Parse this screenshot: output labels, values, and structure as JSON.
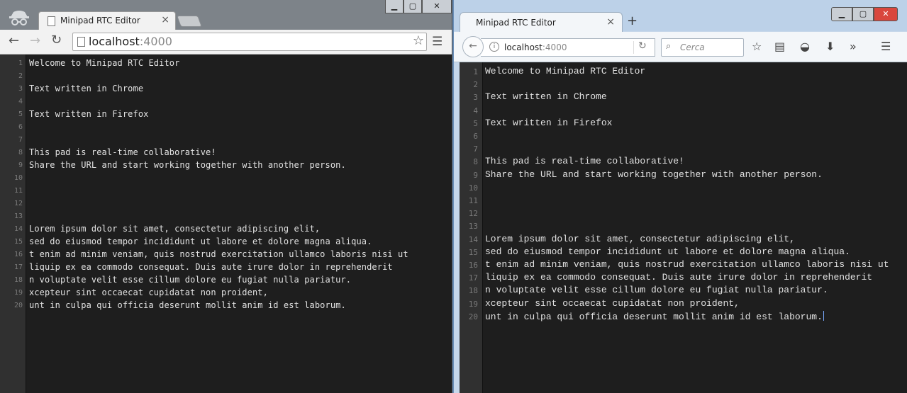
{
  "chrome": {
    "tab_title": "Minipad RTC Editor",
    "tab_close": "×",
    "url_host": "localhost",
    "url_port": ":4000",
    "window_buttons": [
      "▁",
      "▢",
      "✕"
    ]
  },
  "firefox": {
    "tab_title": "Minipad RTC Editor",
    "tab_close": "×",
    "new_tab": "+",
    "url_host": "localhost",
    "url_port": ":4000",
    "search_placeholder": "Cerca",
    "window_buttons": [
      "▁",
      "▢",
      "✕"
    ]
  },
  "editor": {
    "line_numbers": [
      "1",
      "2",
      "3",
      "4",
      "5",
      "6",
      "7",
      "8",
      "9",
      "10",
      "11",
      "12",
      "13",
      "14",
      "15",
      "16",
      "17",
      "18",
      "19",
      "20"
    ],
    "lines": [
      "Welcome to Minipad RTC Editor",
      "",
      "Text written in Chrome",
      "",
      "Text written in Firefox",
      "",
      "",
      "This pad is real-time collaborative!",
      "Share the URL and start working together with another person.",
      "",
      "",
      "",
      "",
      "Lorem ipsum dolor sit amet, consectetur adipiscing elit,",
      "sed do eiusmod tempor incididunt ut labore et dolore magna aliqua.",
      "t enim ad minim veniam, quis nostrud exercitation ullamco laboris nisi ut",
      "liquip ex ea commodo consequat. Duis aute irure dolor in reprehenderit",
      "n voluptate velit esse cillum dolore eu fugiat nulla pariatur.",
      "xcepteur sint occaecat cupidatat non proident,",
      "unt in culpa qui officia deserunt mollit anim id est laborum."
    ]
  }
}
